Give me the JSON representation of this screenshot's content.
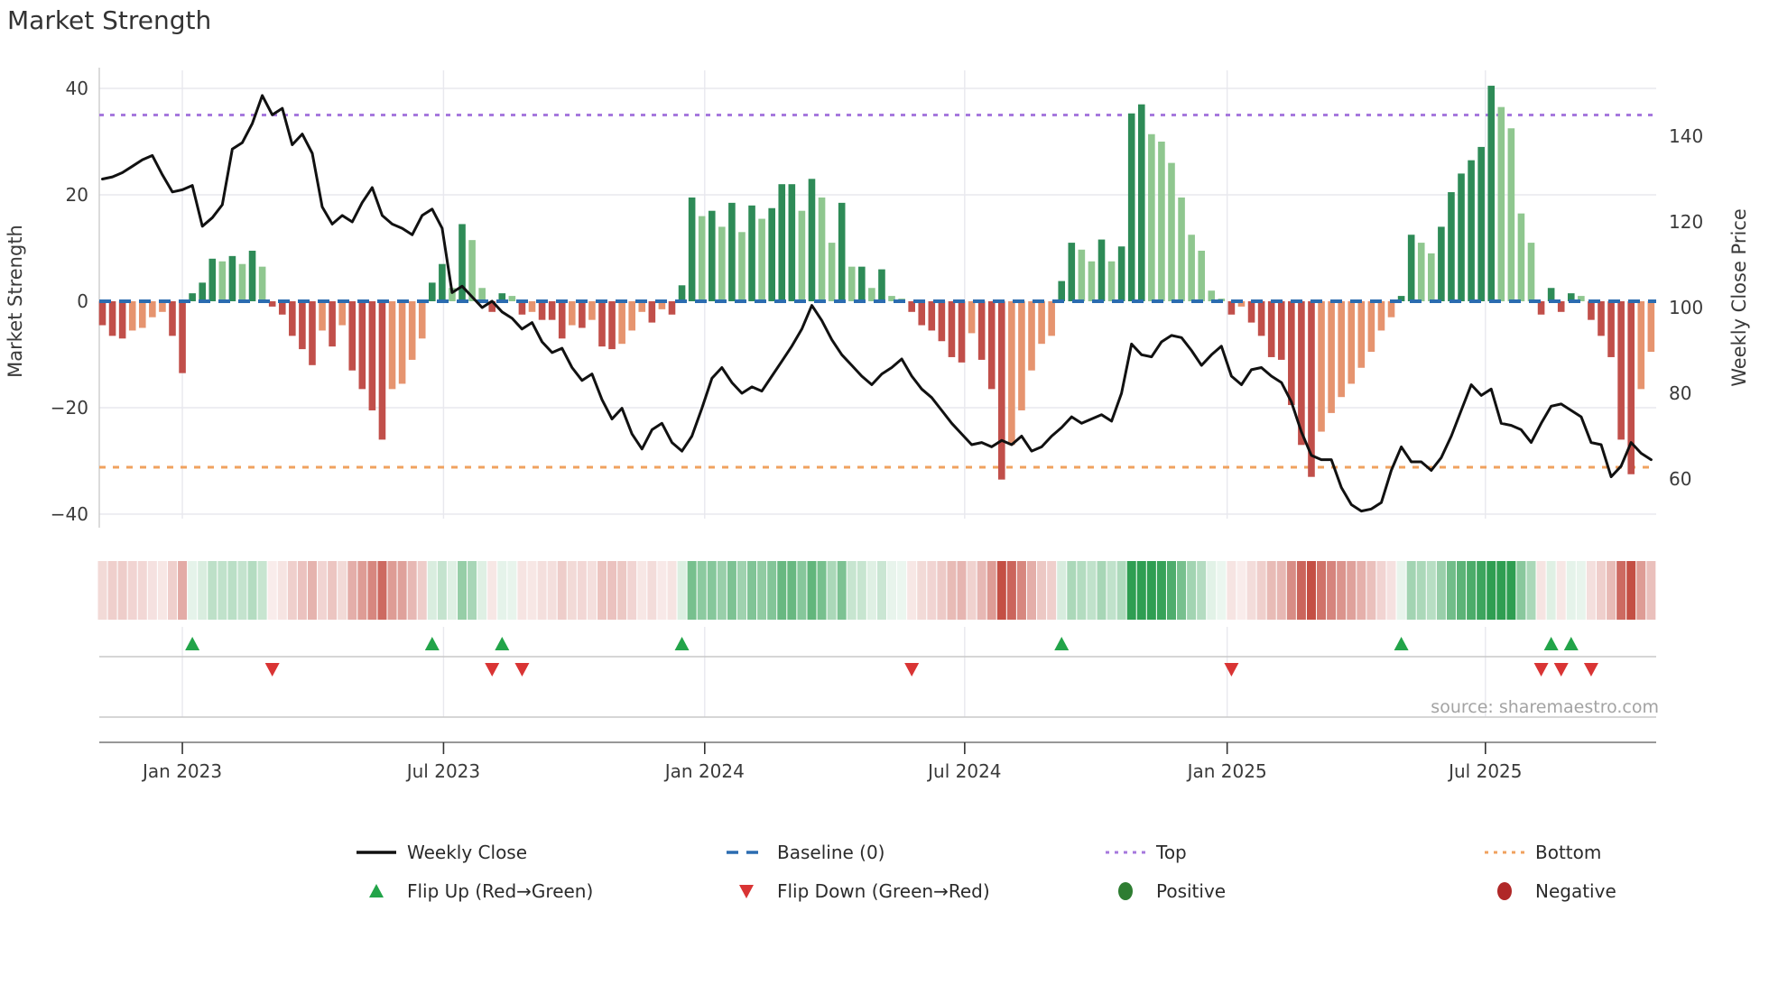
{
  "title": "Market Strength",
  "source_text": "source: sharemaestro.com",
  "chart_data": {
    "type": "bar+line+heatmap",
    "start_date": "2022-11-06",
    "frequency": "weekly",
    "n_weeks": 156,
    "title": "Market Strength",
    "xlabel": "",
    "x_tick_labels": [
      "Jan 2023",
      "Jul 2023",
      "Jan 2024",
      "Jul 2024",
      "Jan 2025",
      "Jul 2025"
    ],
    "x_tick_week_index": [
      8,
      34.14,
      60.28,
      86.3,
      112.57,
      138.42
    ],
    "left_axis": {
      "label": "Market Strength",
      "ticks": [
        40,
        20,
        0,
        -20,
        -40
      ],
      "tick_labels": [
        "40",
        "20",
        "0",
        "−20",
        "−40"
      ],
      "range": [
        -47,
        45
      ]
    },
    "right_axis": {
      "label": "Weekly Close Price",
      "ticks": [
        140,
        120,
        100,
        80,
        60
      ],
      "tick_labels": [
        "140",
        "120",
        "100",
        "80",
        "60"
      ],
      "range": [
        50,
        156
      ]
    },
    "baseline": {
      "label": "Baseline (0)",
      "value": 0
    },
    "top_line": {
      "label": "Top",
      "value": 35
    },
    "bottom_line": {
      "label": "Bottom",
      "value": -30
    },
    "grid": true,
    "series": [
      {
        "name": "Market Strength (weekly bars)",
        "values": [
          -4.5,
          -6.5,
          -7,
          -5.5,
          -5,
          -3,
          -2,
          -6.5,
          -13.5,
          1.5,
          3.5,
          8,
          7.5,
          8.5,
          7,
          9.5,
          6.5,
          -1,
          -2.5,
          -6.5,
          -9,
          -12,
          -5.5,
          -8.5,
          -4.5,
          -13,
          -16.5,
          -20.5,
          -26,
          -16.5,
          -15.5,
          -11,
          -7,
          3.5,
          7,
          2.5,
          14.5,
          11.5,
          2.5,
          -2,
          1.5,
          1,
          -2.5,
          -2,
          -3.5,
          -3.5,
          -7,
          -4.5,
          -5,
          -3.5,
          -8.5,
          -9,
          -8,
          -5.5,
          -2,
          -4,
          -1.5,
          -2.5,
          3,
          19.5,
          16,
          17,
          14,
          18.5,
          13,
          18,
          15.5,
          17.5,
          22,
          22,
          17,
          23,
          19.5,
          11,
          18.5,
          6.5,
          6.5,
          2.5,
          6,
          1,
          0.5,
          -2,
          -4.5,
          -5.5,
          -7.5,
          -10.5,
          -11.5,
          -6,
          -11,
          -16.5,
          -33.5,
          -27,
          -20.5,
          -13,
          -8,
          -6.5,
          3.8,
          11,
          9.7,
          7.5,
          11.6,
          7.5,
          10.3,
          35.3,
          37,
          31.4,
          30,
          26,
          19.5,
          12.5,
          9.5,
          2,
          0.5,
          -2.5,
          -1,
          -4,
          -6.5,
          -10.5,
          -11,
          -19.5,
          -27,
          -33,
          -24.5,
          -21,
          -18,
          -15.5,
          -12.5,
          -9.5,
          -5.5,
          -3,
          1,
          12.5,
          11,
          9,
          14,
          20.5,
          24,
          26.5,
          29,
          40.5,
          36.5,
          32.5,
          16.5,
          11,
          -2.5,
          2.5,
          -2,
          1.5,
          1,
          -3.5,
          -6.5,
          -10.5,
          -26,
          -32.5,
          -16.5,
          -9.5
        ]
      },
      {
        "name": "Weekly Close",
        "values": [
          130,
          130.5,
          131.5,
          133,
          134.5,
          135.5,
          131,
          127,
          127.5,
          128.5,
          119,
          121,
          124,
          137,
          138.5,
          143,
          149.5,
          145,
          146.5,
          138,
          140.5,
          136,
          123.5,
          119.5,
          121.5,
          120,
          124.5,
          128,
          121.5,
          119.5,
          118.5,
          117,
          121.5,
          123,
          118.5,
          103.5,
          105,
          102.5,
          100,
          101.5,
          99,
          97.5,
          95,
          96.5,
          92,
          89.5,
          90.5,
          86,
          83,
          84.5,
          78.5,
          74,
          76.5,
          70.5,
          67,
          71.5,
          73,
          68.5,
          66.5,
          70,
          76.5,
          83.5,
          86,
          82.5,
          80,
          81.5,
          80.5,
          84,
          87.5,
          91,
          95,
          100.5,
          97,
          92.5,
          89,
          86.5,
          84,
          82,
          84.5,
          86,
          88,
          84,
          81,
          79,
          76,
          73,
          70.5,
          68,
          68.5,
          67.5,
          69,
          68,
          70,
          66.5,
          67.5,
          70,
          72,
          74.5,
          73,
          74,
          75,
          73.5,
          80,
          91.5,
          89,
          88.5,
          92,
          93.5,
          93,
          90,
          86.5,
          89,
          91,
          84,
          82,
          85.5,
          86,
          84,
          82.5,
          78,
          71,
          65.5,
          64.5,
          64.5,
          58,
          54,
          52.5,
          53,
          54.5,
          62,
          67.5,
          64,
          64,
          62,
          65,
          70,
          76,
          82,
          79.5,
          81,
          73,
          72.5,
          71.5,
          68.5,
          73,
          77,
          77.5,
          76,
          74.5,
          68.5,
          68,
          60.5,
          63,
          68.5,
          66,
          64.5
        ]
      }
    ],
    "flip_up_weeks": [
      9,
      33,
      40,
      58,
      96,
      130,
      145,
      147
    ],
    "flip_down_weeks": [
      17,
      39,
      42,
      81,
      113,
      144,
      146,
      149
    ],
    "heatmap": {
      "description": "weekly strip, same weekly strength values, green positive / red negative, intensity by magnitude"
    },
    "colors": {
      "positive_dark": "#2e8b57",
      "positive_light": "#8fc78f",
      "negative_dark": "#c14f4a",
      "negative_light": "#e6946f",
      "weekly_close_line": "#111111",
      "baseline": "#2b6cb0",
      "top_line": "#a678dd",
      "bottom_line": "#f0a25f",
      "flip_up_marker": "#22a449",
      "flip_down_marker": "#d93434",
      "positive_legend_dot": "#2e7d32",
      "negative_legend_dot": "#b02828",
      "heatmap_green": "#2f9e52",
      "heatmap_red": "#c44f44",
      "grid": "#e8e8ee"
    },
    "legend_position": "bottom"
  },
  "legend": {
    "row1": [
      {
        "type": "line",
        "label": "Weekly Close"
      },
      {
        "type": "dashed",
        "label": "Baseline (0)"
      },
      {
        "type": "dotted-purple",
        "label": "Top"
      },
      {
        "type": "dotted-orange",
        "label": "Bottom"
      }
    ],
    "row2": [
      {
        "type": "triangle-up",
        "label": "Flip Up (Red→Green)"
      },
      {
        "type": "triangle-down",
        "label": "Flip Down (Green→Red)"
      },
      {
        "type": "circle-green",
        "label": "Positive"
      },
      {
        "type": "circle-red",
        "label": "Negative"
      }
    ]
  }
}
